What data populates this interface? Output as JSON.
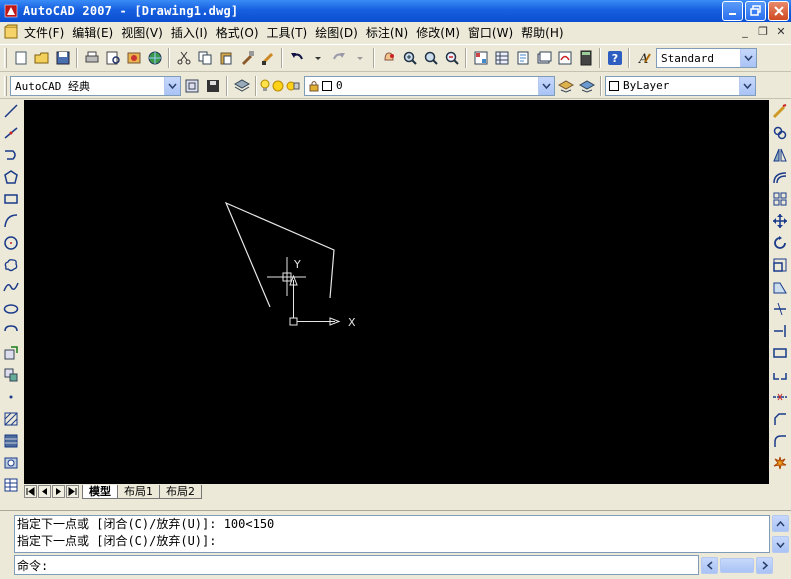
{
  "window": {
    "title": "AutoCAD 2007 - [Drawing1.dwg]"
  },
  "menu": {
    "items": [
      "文件(F)",
      "编辑(E)",
      "视图(V)",
      "插入(I)",
      "格式(O)",
      "工具(T)",
      "绘图(D)",
      "标注(N)",
      "修改(M)",
      "窗口(W)",
      "帮助(H)"
    ]
  },
  "toolbars": {
    "text_style": "Standard",
    "workspace": "AutoCAD 经典",
    "layer": "0",
    "color": "ByLayer"
  },
  "ucs": {
    "x_label": "X",
    "y_label": "Y"
  },
  "layout_tabs": [
    "模型",
    "布局1",
    "布局2"
  ],
  "command": {
    "history": [
      "指定下一点或 [闭合(C)/放弃(U)]: 100<150",
      "指定下一点或 [闭合(C)/放弃(U)]:"
    ],
    "prompt": "命令:"
  },
  "colors": {
    "titlebar": "#0b4fd1",
    "canvas_bg": "#000000",
    "drawing_line": "#ffffff",
    "chrome": "#ece9d8"
  },
  "icons": {
    "app": "autocad-icon",
    "minimize": "minimize-icon",
    "restore": "restore-icon",
    "close": "close-icon"
  }
}
